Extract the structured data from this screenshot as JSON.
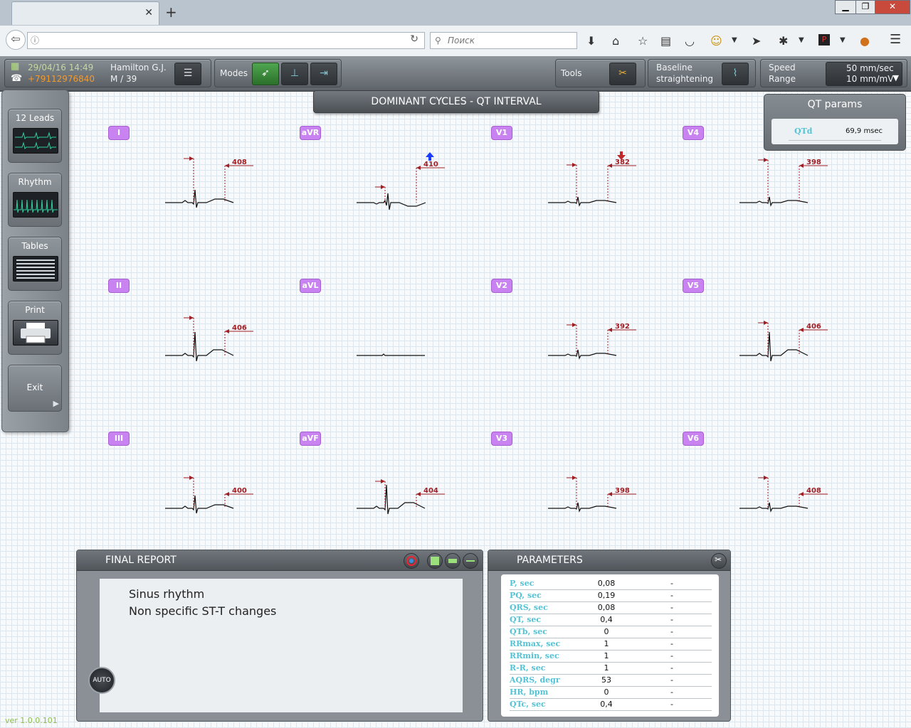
{
  "browser": {
    "search_placeholder": "Поиск",
    "url_value": "",
    "tab_title": ""
  },
  "header": {
    "datetime": "29/04/16 14:49",
    "phone": "+79112976840",
    "patient_name": "Hamilton G.J.",
    "patient_sex_age": "M / 39",
    "modes_label": "Modes",
    "tools_label": "Tools",
    "baseline_line1": "Baseline",
    "baseline_line2": "straightening",
    "speed_label": "Speed",
    "range_label": "Range",
    "speed_value": "50 mm/sec",
    "range_value": "10 mm/mV"
  },
  "sidebar": {
    "leads12": "12 Leads",
    "rhythm": "Rhythm",
    "tables": "Tables",
    "print": "Print",
    "exit": "Exit"
  },
  "main_title": "DOMINANT CYCLES - QT INTERVAL",
  "qt_params": {
    "title": "QT params",
    "name": "QTd",
    "value": "69,9 msec"
  },
  "leads": [
    {
      "name": "I",
      "qt": "408",
      "marker": ""
    },
    {
      "name": "aVR",
      "qt": "410",
      "marker": "max"
    },
    {
      "name": "V1",
      "qt": "382",
      "marker": "min"
    },
    {
      "name": "V4",
      "qt": "398",
      "marker": ""
    },
    {
      "name": "II",
      "qt": "406",
      "marker": ""
    },
    {
      "name": "aVL",
      "qt": "",
      "marker": ""
    },
    {
      "name": "V2",
      "qt": "392",
      "marker": ""
    },
    {
      "name": "V5",
      "qt": "406",
      "marker": ""
    },
    {
      "name": "III",
      "qt": "400",
      "marker": ""
    },
    {
      "name": "aVF",
      "qt": "404",
      "marker": ""
    },
    {
      "name": "V3",
      "qt": "398",
      "marker": ""
    },
    {
      "name": "V6",
      "qt": "408",
      "marker": ""
    }
  ],
  "final_report": {
    "title": "FINAL REPORT",
    "line1": "Sinus rhythm",
    "line2": "Non specific ST-T changes",
    "auto_label": "AUTO"
  },
  "parameters": {
    "title": "PARAMETERS",
    "rows": [
      {
        "name": "P, sec",
        "value": "0,08",
        "extra": "-"
      },
      {
        "name": "PQ, sec",
        "value": "0,19",
        "extra": "-"
      },
      {
        "name": "QRS, sec",
        "value": "0,08",
        "extra": "-"
      },
      {
        "name": "QT, sec",
        "value": "0,4",
        "extra": "-"
      },
      {
        "name": "QTb, sec",
        "value": "0",
        "extra": "-"
      },
      {
        "name": "RRmax, sec",
        "value": "1",
        "extra": "-"
      },
      {
        "name": "RRmin, sec",
        "value": "1",
        "extra": "-"
      },
      {
        "name": "R-R, sec",
        "value": "1",
        "extra": "-"
      },
      {
        "name": "AQRS, degr",
        "value": "53",
        "extra": "-"
      },
      {
        "name": "HR, bpm",
        "value": "0",
        "extra": "-"
      },
      {
        "name": "QTc, sec",
        "value": "0,4",
        "extra": "-"
      }
    ]
  },
  "version": "ver 1.0.0.101",
  "colors": {
    "lead_badge": "#c883f0",
    "qt_marker": "#a01f24",
    "param_name": "#53c3d6",
    "max_arrow": "#1a3cff",
    "min_arrow": "#c0282c",
    "phone": "#f29a2e",
    "datetime": "#c8d6a0"
  },
  "icons": [
    "back-icon",
    "info-icon",
    "reload-icon",
    "search-icon",
    "download-icon",
    "home-icon",
    "bookmark-star-icon",
    "reader-icon",
    "pocket-icon",
    "emoji-icon",
    "send-icon",
    "puzzle-icon",
    "pdf-icon",
    "extension-icon",
    "menu-icon",
    "phone-icon",
    "list-icon",
    "pointer-mode-icon",
    "measure-mode-icon",
    "caliper-mode-icon",
    "tools-icon",
    "baseline-icon",
    "dropdown-arrow-icon",
    "color-wheel-icon",
    "window-large-icon",
    "window-medium-icon",
    "window-small-icon",
    "parameters-tools-icon"
  ]
}
